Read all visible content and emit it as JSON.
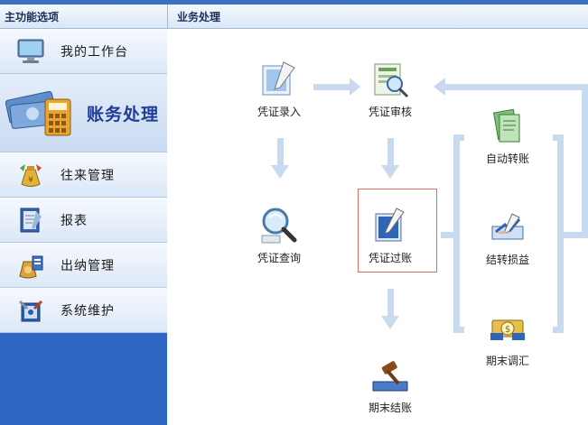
{
  "sidebar": {
    "header": "主功能选项",
    "items": [
      {
        "label": "我的工作台",
        "icon": "monitor-icon"
      },
      {
        "label": "账务处理",
        "icon": "money-calculator-icon"
      },
      {
        "label": "往来管理",
        "icon": "money-bag-icon"
      },
      {
        "label": "报表",
        "icon": "report-icon"
      },
      {
        "label": "出纳管理",
        "icon": "cashier-bag-icon"
      },
      {
        "label": "系统维护",
        "icon": "tools-icon"
      }
    ]
  },
  "main": {
    "header": "业务处理",
    "nodes": {
      "entry": "凭证录入",
      "audit": "凭证审核",
      "query": "凭证查询",
      "post": "凭证过账",
      "auto_transfer": "自动转账",
      "profit_loss": "结转损益",
      "adjust": "期末调汇",
      "close": "期末结账"
    }
  },
  "colors": {
    "accent": "#2f68c4",
    "arrow": "#c7daf0",
    "highlight": "#e06a6a"
  }
}
